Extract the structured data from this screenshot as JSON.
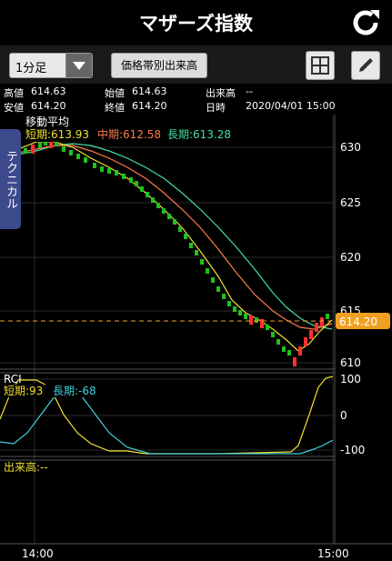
{
  "header": {
    "title": "マザーズ指数"
  },
  "toolbar": {
    "period": "1分足",
    "volume_button": "価格帯別出来高"
  },
  "ohlc": {
    "high_label": "高値",
    "high": "614.63",
    "open_label": "始値",
    "open": "614.63",
    "volume_label": "出来高",
    "volume": "--",
    "low_label": "安値",
    "low": "614.20",
    "close_label": "終値",
    "close": "614.20",
    "date_label": "日時",
    "date": "2020/04/01 15:00"
  },
  "ma": {
    "title": "移動平均",
    "short": "短期:613.93",
    "mid": "中期:612.58",
    "long": "長期:613.28",
    "short_color": "#f0e030",
    "mid_color": "#ff7a4a",
    "long_color": "#40e0a0"
  },
  "side_tab": "テクニカル",
  "price_axis": [
    "630",
    "625",
    "620",
    "615",
    "610"
  ],
  "current_price": "614.20",
  "rci": {
    "title": "RCI",
    "short": "短期:93",
    "long": "長期:-68",
    "axis": [
      "100",
      "0",
      "-100"
    ]
  },
  "volume_panel": {
    "label": "出来高:--"
  },
  "time_axis": [
    "14:00",
    "15:00"
  ],
  "colors": {
    "up": "#ff3030",
    "down": "#20c020",
    "grid": "#2a2a2a",
    "current": "#f0a020"
  },
  "icons": {
    "refresh": "refresh-icon",
    "grid": "grid-icon",
    "pencil": "pencil-icon",
    "dropdown": "chevron-down-icon"
  }
}
